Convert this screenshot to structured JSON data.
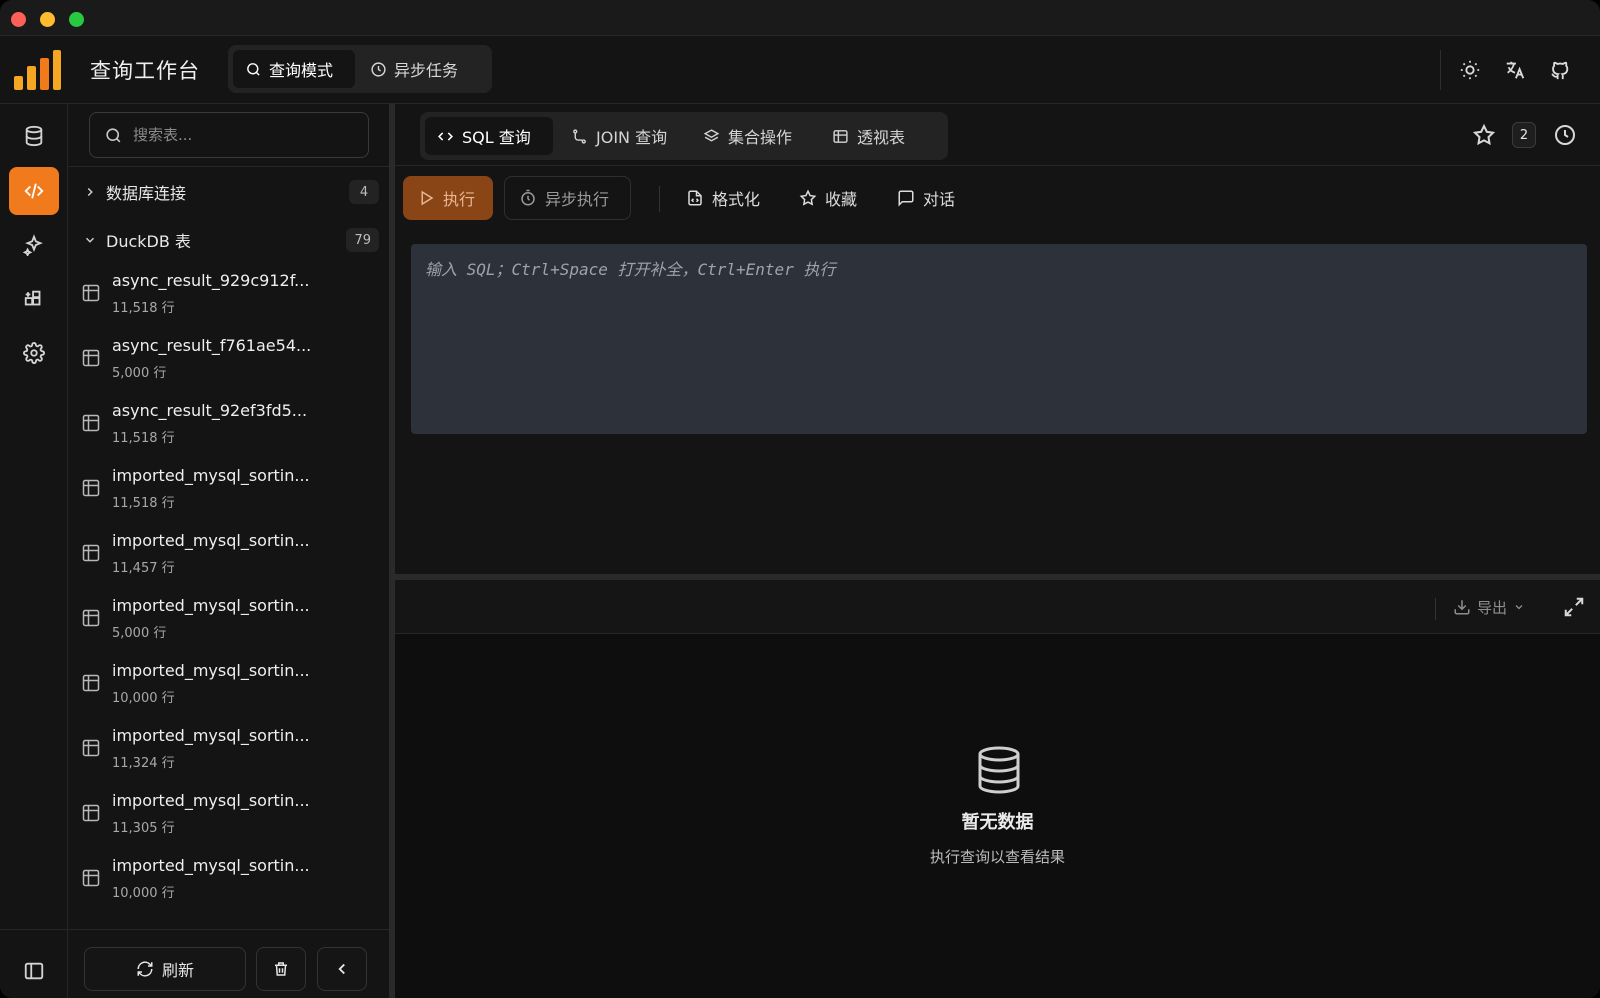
{
  "header": {
    "title": "查询工作台",
    "modes": [
      {
        "label": "查询模式",
        "icon": "search-icon",
        "active": true
      },
      {
        "label": "异步任务",
        "icon": "clock-icon",
        "active": false
      }
    ],
    "actions": [
      "sun-icon",
      "translate-icon",
      "github-icon"
    ]
  },
  "rail": {
    "items": [
      "database-icon",
      "code-icon",
      "sparkle-icon",
      "grid-plus-icon",
      "gear-icon"
    ],
    "active": "code-icon",
    "bottom": "sidebar-toggle-icon"
  },
  "sidebar": {
    "search_placeholder": "搜索表...",
    "groups": [
      {
        "label": "数据库连接",
        "count": "4",
        "expanded": false
      },
      {
        "label": "DuckDB 表",
        "count": "79",
        "expanded": true
      }
    ],
    "tables": [
      {
        "name": "async_result_929c912f...",
        "rows": "11,518 行"
      },
      {
        "name": "async_result_f761ae54...",
        "rows": "5,000 行"
      },
      {
        "name": "async_result_92ef3fd5...",
        "rows": "11,518 行"
      },
      {
        "name": "imported_mysql_sortin...",
        "rows": "11,518 行"
      },
      {
        "name": "imported_mysql_sortin...",
        "rows": "11,457 行"
      },
      {
        "name": "imported_mysql_sortin...",
        "rows": "5,000 行"
      },
      {
        "name": "imported_mysql_sortin...",
        "rows": "10,000 行"
      },
      {
        "name": "imported_mysql_sortin...",
        "rows": "11,324 行"
      },
      {
        "name": "imported_mysql_sortin...",
        "rows": "11,305 行"
      },
      {
        "name": "imported_mysql_sortin...",
        "rows": "10,000 行"
      }
    ],
    "refresh_label": "刷新"
  },
  "main": {
    "tabs": [
      {
        "label": "SQL 查询",
        "icon": "code-icon",
        "active": true
      },
      {
        "label": "JOIN 查询",
        "icon": "join-icon",
        "active": false
      },
      {
        "label": "集合操作",
        "icon": "layers-icon",
        "active": false
      },
      {
        "label": "透视表",
        "icon": "table-icon",
        "active": false
      }
    ],
    "history_count": "2",
    "toolbar": {
      "run_label": "执行",
      "async_label": "异步执行",
      "format_label": "格式化",
      "favorite_label": "收藏",
      "chat_label": "对话"
    },
    "editor_placeholder": "输入 SQL；Ctrl+Space 打开补全，Ctrl+Enter 执行",
    "export_label": "导出",
    "empty_title": "暂无数据",
    "empty_subtitle": "执行查询以查看结果"
  },
  "colors": {
    "accent": "#f07a1c",
    "background": "#141414",
    "editor_bg": "#2c313a"
  }
}
